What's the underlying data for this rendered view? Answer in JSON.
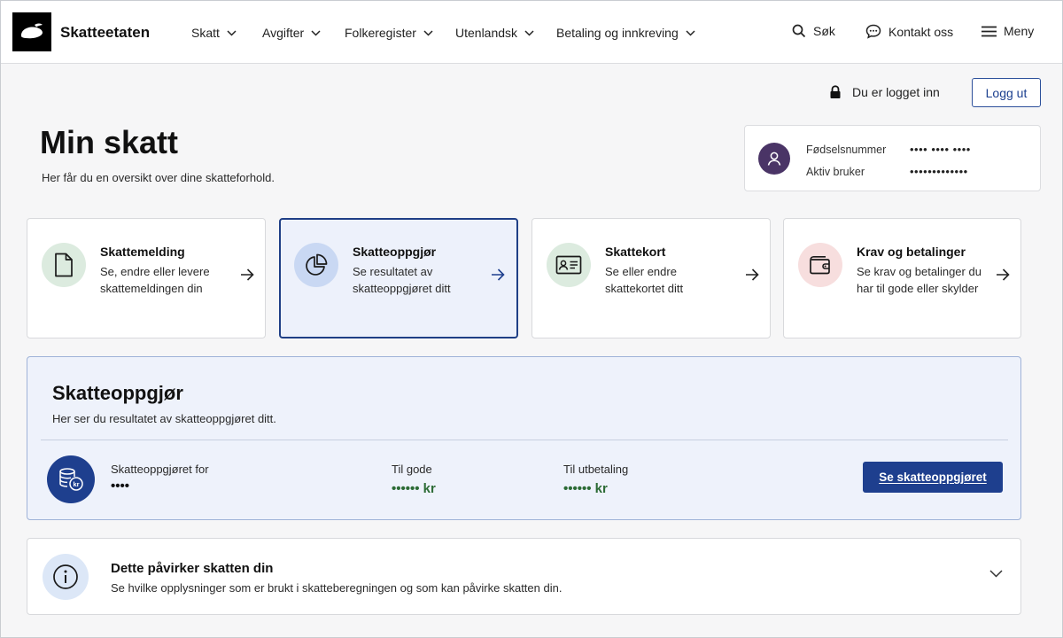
{
  "header": {
    "brand": "Skatteetaten",
    "nav": [
      {
        "label": "Skatt"
      },
      {
        "label": "Avgifter"
      },
      {
        "label": "Folkeregister"
      },
      {
        "label": "Utenlandsk"
      },
      {
        "label": "Betaling og innkreving"
      }
    ],
    "search_label": "Søk",
    "contact_label": "Kontakt oss",
    "menu_label": "Meny"
  },
  "session": {
    "status": "Du er logget inn",
    "logout_label": "Logg ut"
  },
  "page": {
    "title": "Min skatt",
    "subtitle": "Her får du en oversikt over dine skatteforhold."
  },
  "user": {
    "ssn_label": "Fødselsnummer",
    "ssn_value": "•••• •••• ••••",
    "active_label": "Aktiv bruker",
    "active_value": "•••••••••••••"
  },
  "cards": [
    {
      "title": "Skattemelding",
      "desc": "Se, endre eller levere skattemeldingen din",
      "icon": "document-icon",
      "color": "#dcebdf"
    },
    {
      "title": "Skatteoppgjør",
      "desc": "Se resultatet av skatteoppgjøret ditt",
      "icon": "pie-chart-icon",
      "color": "#c9d8f3"
    },
    {
      "title": "Skattekort",
      "desc": "Se eller endre skattekortet ditt",
      "icon": "id-card-icon",
      "color": "#dcebdf"
    },
    {
      "title": "Krav og betalinger",
      "desc": "Se krav og betalinger du har til gode eller skylder",
      "icon": "wallet-icon",
      "color": "#f7dede"
    }
  ],
  "settlement": {
    "title": "Skatteoppgjør",
    "subtitle": "Her ser du resultatet av skatteoppgjøret ditt.",
    "year_label": "Skatteoppgjøret for",
    "year_value": "••••",
    "credit_label": "Til gode",
    "credit_value": "•••••• kr",
    "payout_label": "Til utbetaling",
    "payout_value": "•••••• kr",
    "button_label": "Se skatteoppgjøret",
    "value_color": "#2c6b35"
  },
  "info": {
    "title": "Dette påvirker skatten din",
    "desc": "Se hvilke opplysninger som er brukt i skatteberegningen og som kan påvirke skatten din."
  },
  "colors": {
    "primary": "#1e3f8e",
    "avatar": "#4a3466"
  }
}
